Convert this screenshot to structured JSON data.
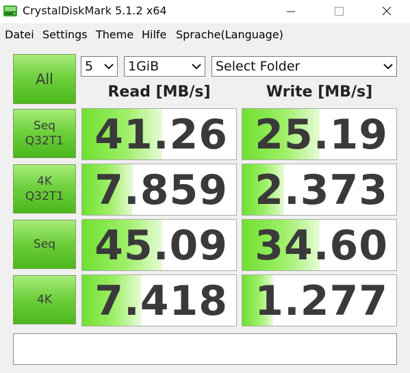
{
  "window": {
    "title": "CrystalDiskMark 5.1.2 x64",
    "controls": {
      "minimize": "—",
      "maximize": "☐",
      "close": "✕"
    }
  },
  "menu": [
    "Datei",
    "Settings",
    "Theme",
    "Hilfe",
    "Sprache(Language)"
  ],
  "toolbar": {
    "all_label": "All",
    "count_value": "5",
    "size_value": "1GiB",
    "folder_value": "Select Folder"
  },
  "headers": {
    "read": "Read [MB/s]",
    "write": "Write [MB/s]"
  },
  "tests": [
    {
      "label": "Seq\nQ32T1",
      "read": "41.26",
      "write": "25.19",
      "read_fill": 0.52,
      "write_fill": 0.5
    },
    {
      "label": "4K\nQ32T1",
      "read": "7.859",
      "write": "2.373",
      "read_fill": 0.33,
      "write_fill": 0.27
    },
    {
      "label": "Seq",
      "read": "45.09",
      "write": "34.60",
      "read_fill": 0.52,
      "write_fill": 0.5
    },
    {
      "label": "4K",
      "read": "7.418",
      "write": "1.277",
      "read_fill": 0.38,
      "write_fill": 0.2
    }
  ],
  "comment": "",
  "colors": {
    "accent_green": "#6fd13e",
    "value_text": "#3a3a3a"
  }
}
